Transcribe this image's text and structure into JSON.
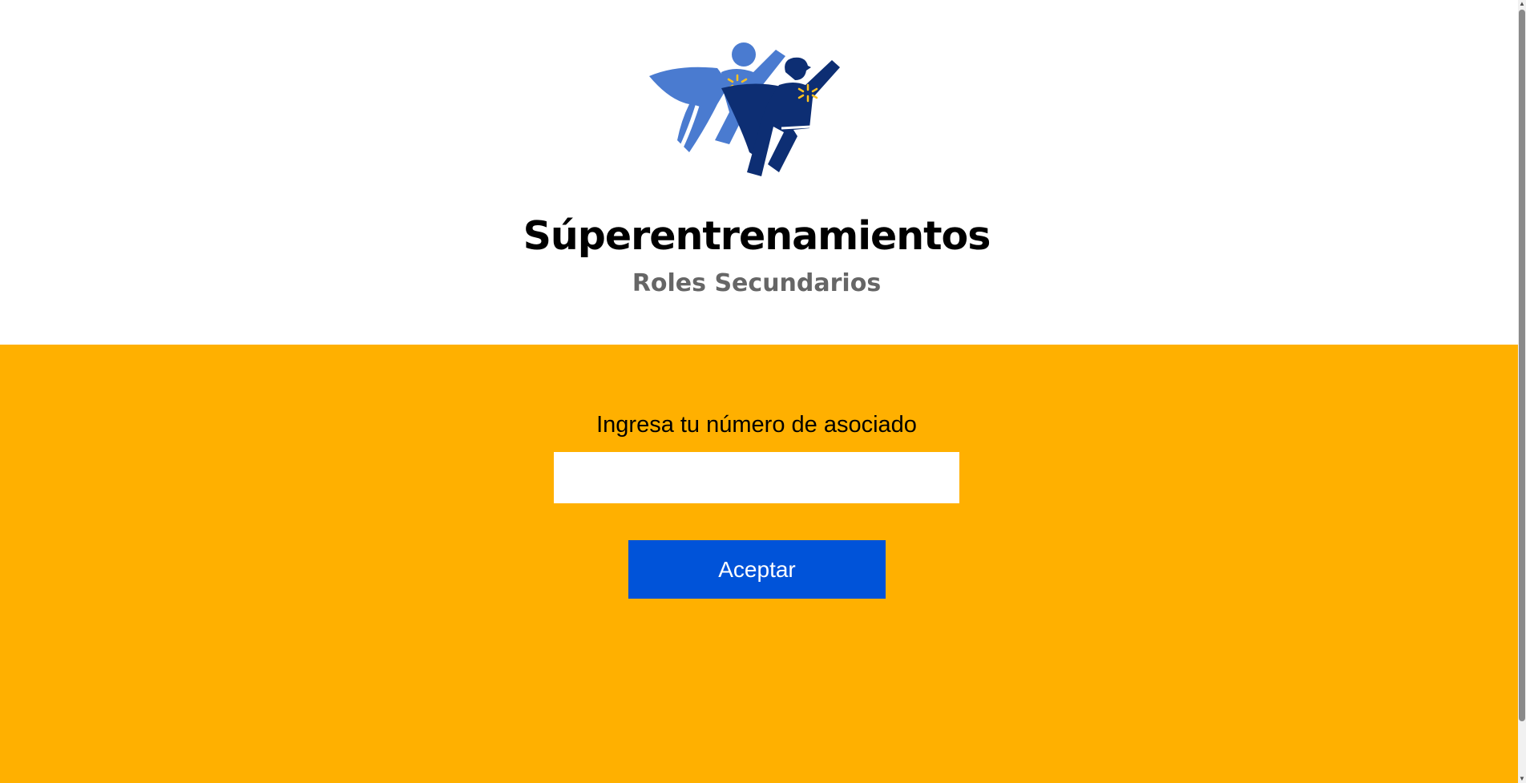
{
  "header": {
    "title": "Súperentrenamientos",
    "subtitle": "Roles Secundarios",
    "logo_icon": "superheroes-logo-icon"
  },
  "form": {
    "label": "Ingresa tu número de asociado",
    "input_value": "",
    "input_placeholder": "",
    "submit_label": "Aceptar"
  },
  "colors": {
    "panel_background": "#ffb000",
    "button_background": "#0053d9",
    "title_color": "#000000",
    "subtitle_color": "#666666",
    "hero_light_blue": "#4a7bd0",
    "hero_dark_blue": "#0d2e73",
    "spark_yellow": "#ffc220"
  },
  "scrollbar": {
    "up_arrow_icon": "scroll-up-arrow-icon",
    "down_arrow_icon": "scroll-down-arrow-icon"
  }
}
